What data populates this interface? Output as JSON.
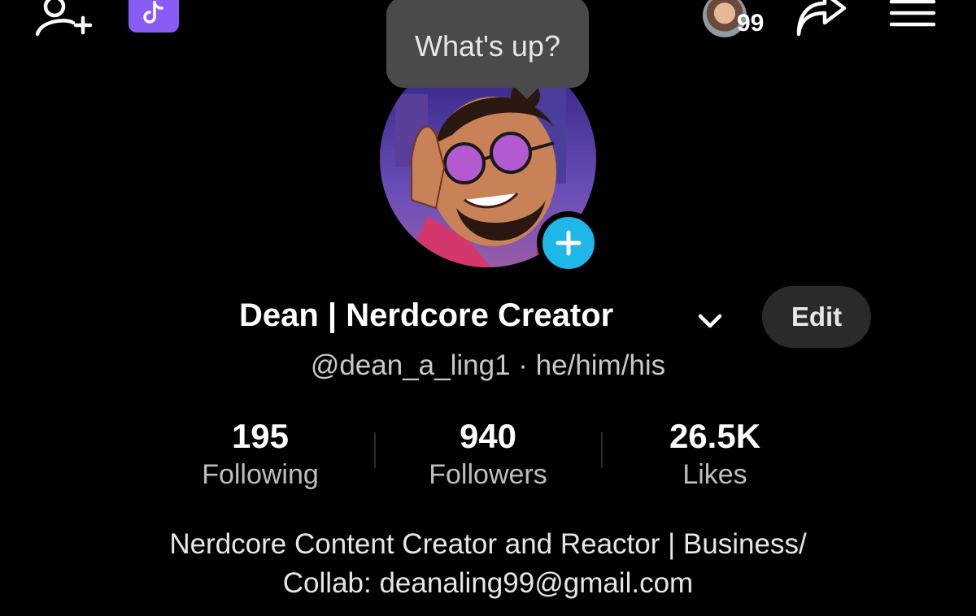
{
  "top_bar": {
    "notification_count": "99"
  },
  "tooltip": {
    "text": "What's up?"
  },
  "profile": {
    "display_name": "Dean | Nerdcore Creator",
    "edit_label": "Edit",
    "handle_line": "@dean_a_ling1 · he/him/his",
    "stats": [
      {
        "value": "195",
        "label": "Following"
      },
      {
        "value": "940",
        "label": "Followers"
      },
      {
        "value": "26.5K",
        "label": "Likes"
      }
    ],
    "bio_lines": [
      "Nerdcore Content Creator and Reactor | Business/",
      "Collab: deanaling99@gmail.com"
    ]
  },
  "colors": {
    "background": "#000000",
    "accent_plus": "#1fb6e8",
    "tiktok_badge": "#8a5cf6",
    "tooltip_bg": "#4a4a4a",
    "edit_button_bg": "#2a2a2a"
  },
  "icons": [
    "add-friend-icon",
    "tiktok-badge-icon",
    "share-icon",
    "menu-icon",
    "chevron-down-icon",
    "plus-icon"
  ]
}
